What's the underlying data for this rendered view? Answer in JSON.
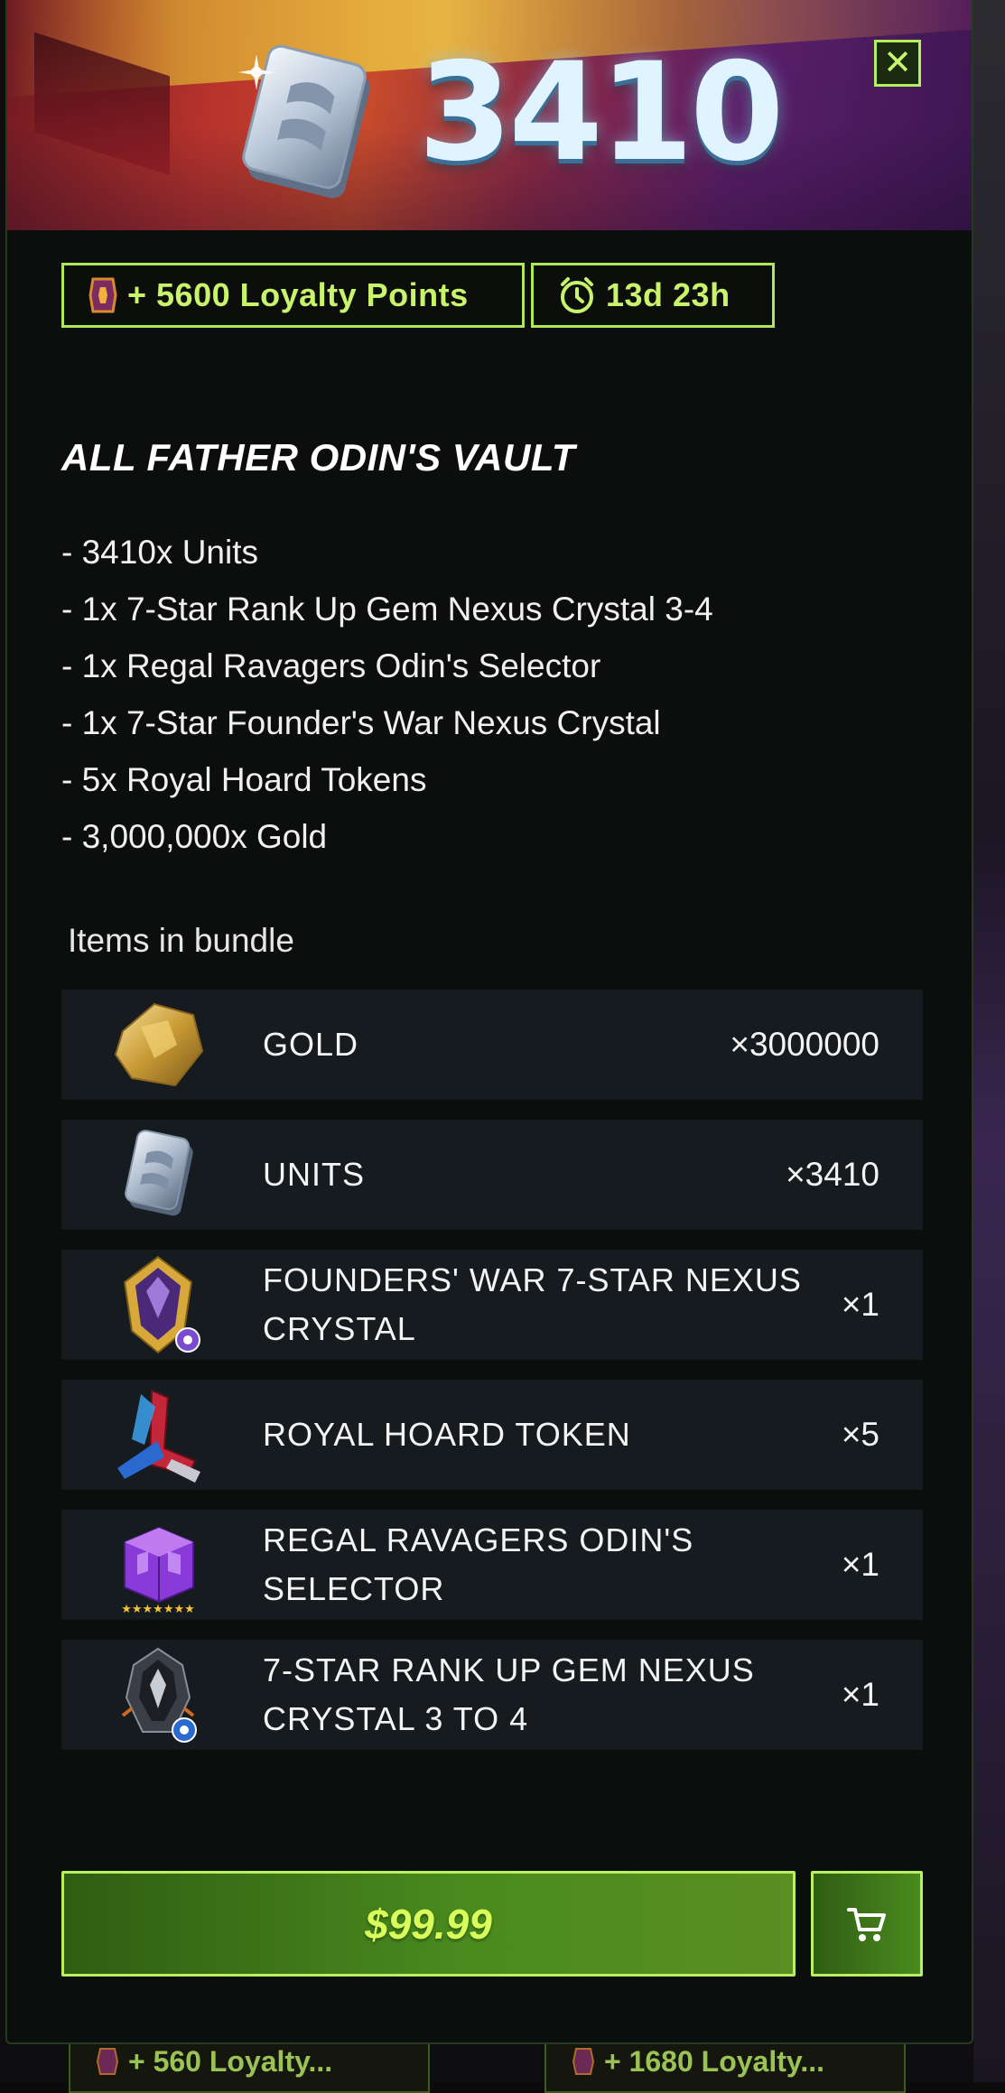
{
  "banner": {
    "amount_text": "3410"
  },
  "tags": {
    "loyalty_text": "+ 5600 Loyalty Points",
    "timer_text": "13d 23h"
  },
  "bundle": {
    "title": "ALL FATHER ODIN'S VAULT",
    "description": [
      "- 3410x Units",
      "- 1x 7-Star Rank Up Gem Nexus Crystal 3-4",
      "- 1x Regal Ravagers Odin's Selector",
      "- 1x 7-Star Founder's War Nexus Crystal",
      "- 5x Royal Hoard Tokens",
      "- 3,000,000x Gold"
    ],
    "items_heading": "Items in bundle",
    "items": [
      {
        "name": "GOLD",
        "qty": "×3000000",
        "icon": "gold-icon"
      },
      {
        "name": "UNITS",
        "qty": "×3410",
        "icon": "units-icon"
      },
      {
        "name": "FOUNDERS' WAR 7-STAR NEXUS CRYSTAL",
        "qty": "×1",
        "icon": "founders-crystal-icon"
      },
      {
        "name": "ROYAL HOARD TOKEN",
        "qty": "×5",
        "icon": "royal-hoard-token-icon"
      },
      {
        "name": "REGAL RAVAGERS ODIN'S SELECTOR",
        "qty": "×1",
        "icon": "selector-icon"
      },
      {
        "name": "7-STAR RANK UP GEM NEXUS CRYSTAL 3 TO 4",
        "qty": "×1",
        "icon": "rank-up-gem-icon"
      }
    ]
  },
  "purchase": {
    "price_label": "$99.99",
    "cart_icon": "cart-icon"
  },
  "background_cards": [
    {
      "label": "+ 560 Loyalty..."
    },
    {
      "label": "+ 1680 Loyalty..."
    }
  ],
  "colors": {
    "accent": "#b4f05a",
    "button_green": "#4a8a1e",
    "panel": "#0b0e0d",
    "row": "#151b1e"
  }
}
